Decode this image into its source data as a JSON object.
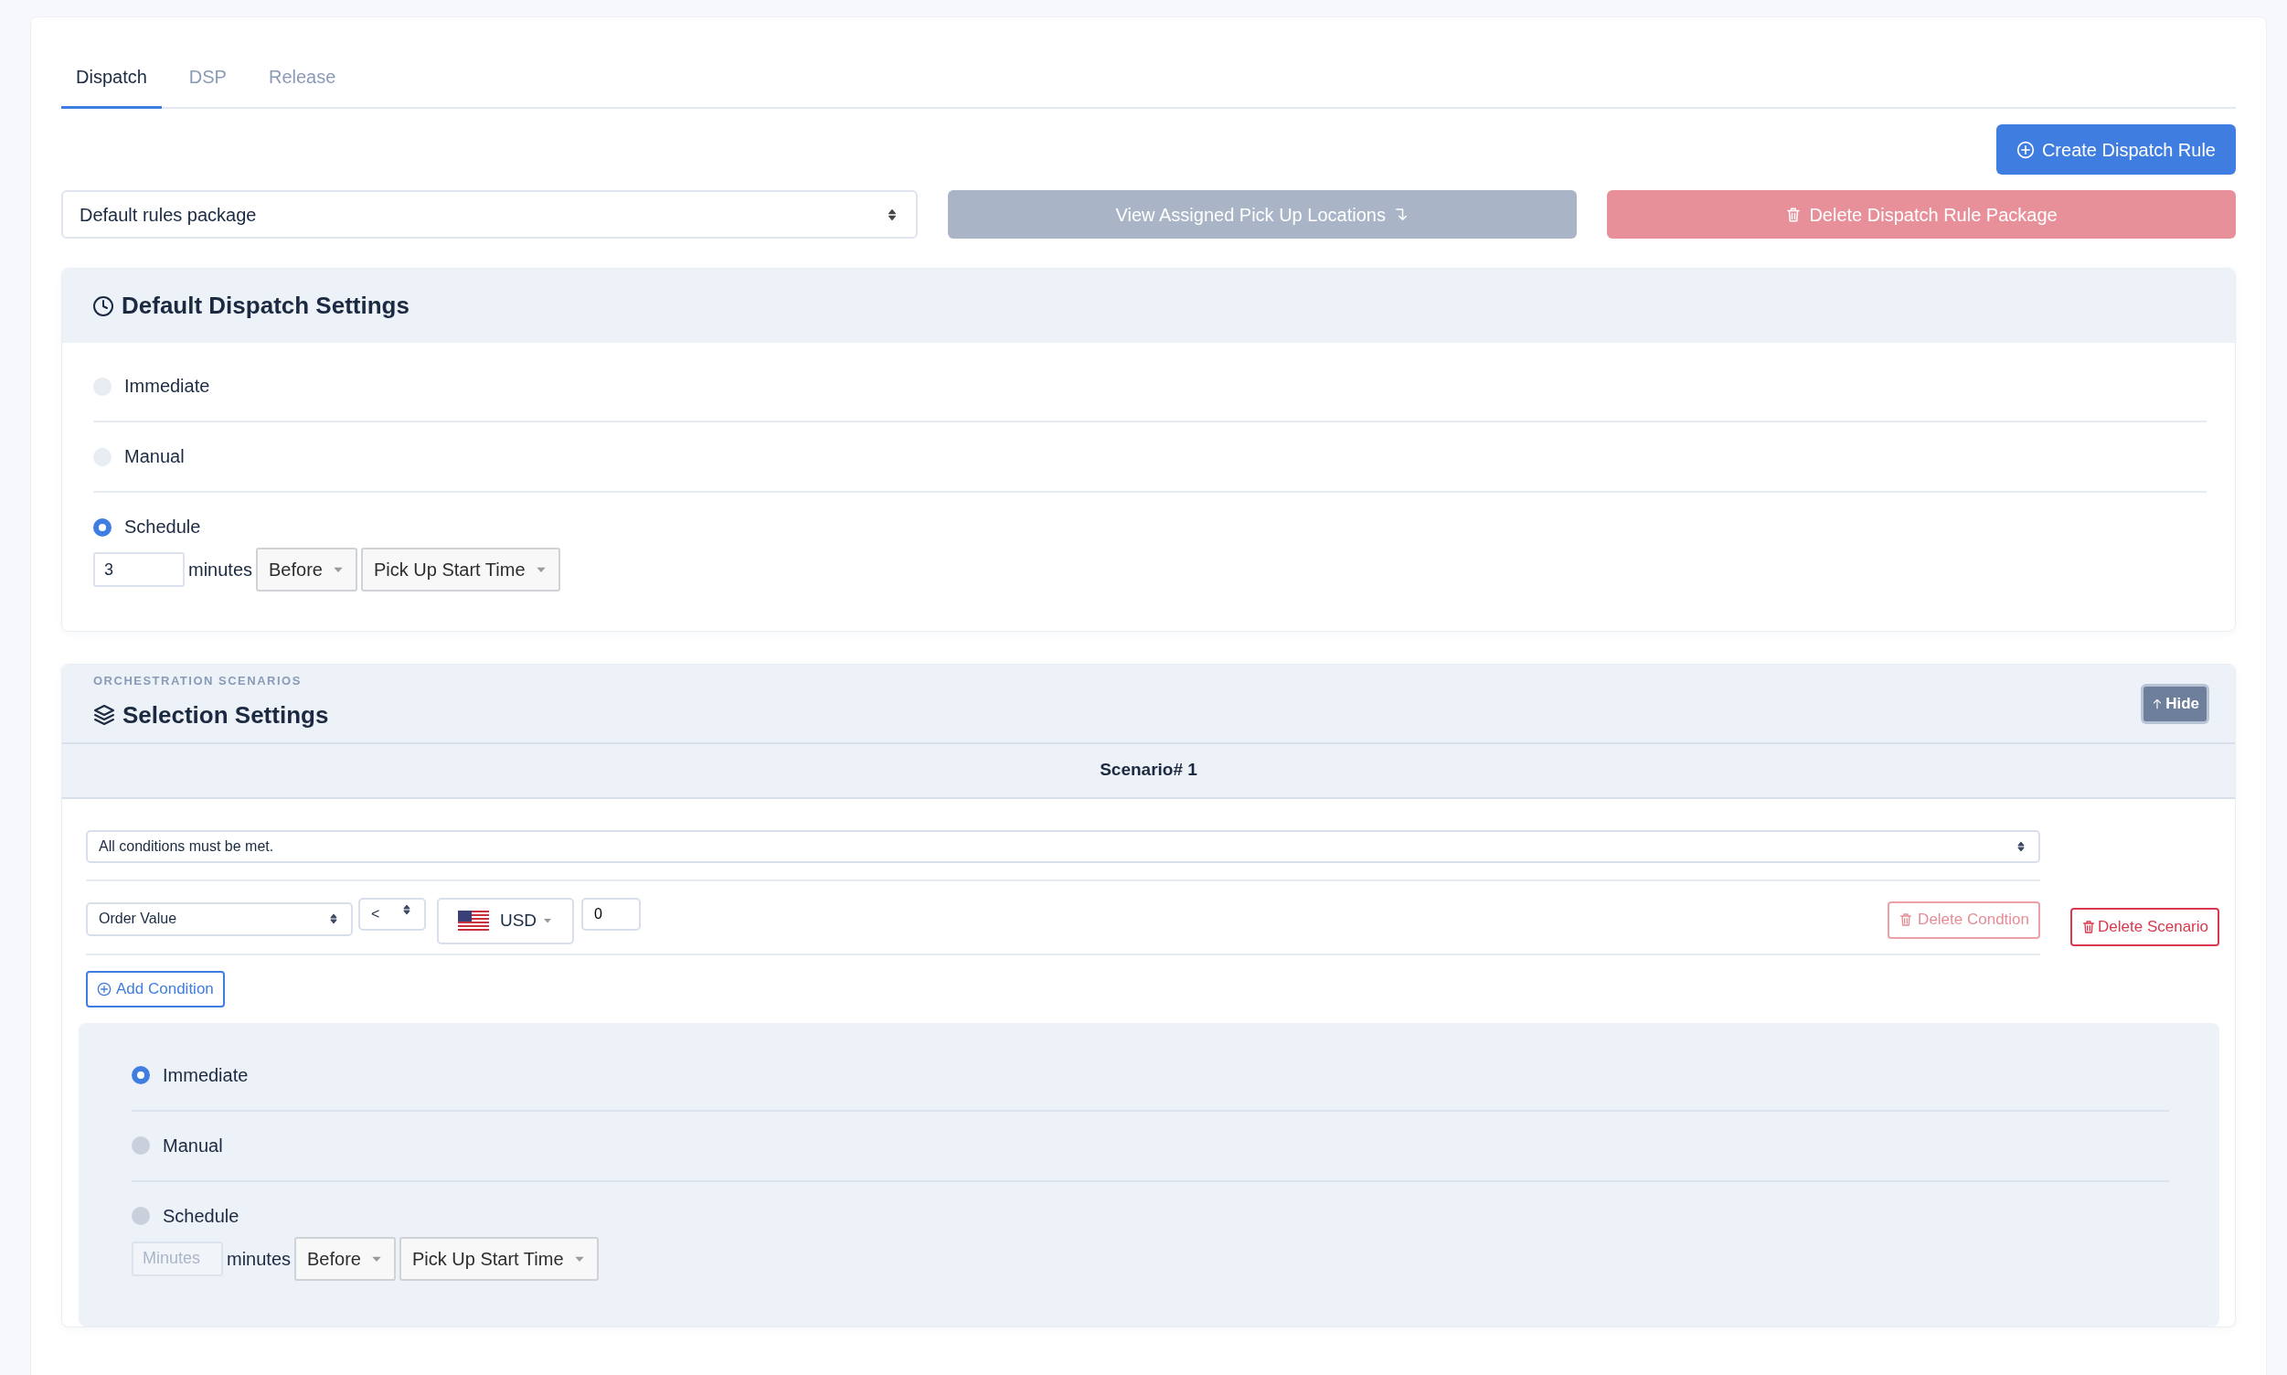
{
  "tabs": [
    {
      "label": "Dispatch",
      "selected": true
    },
    {
      "label": "DSP",
      "selected": false
    },
    {
      "label": "Release",
      "selected": false
    }
  ],
  "create_button": "Create Dispatch Rule",
  "package_select": {
    "value": "Default rules package"
  },
  "view_button": "View Assigned Pick Up Locations",
  "delete_package_button": "Delete Dispatch Rule Package",
  "default_settings": {
    "title": "Default Dispatch Settings",
    "options": [
      {
        "label": "Immediate",
        "selected": false
      },
      {
        "label": "Manual",
        "selected": false
      },
      {
        "label": "Schedule",
        "selected": true
      }
    ],
    "schedule": {
      "minutes_value": "3",
      "unit": "minutes",
      "relation": "Before",
      "reference": "Pick Up Start Time"
    }
  },
  "selection_settings": {
    "eyebrow": "ORCHESTRATION SCENARIOS",
    "title": "Selection Settings",
    "hide_button": "Hide",
    "scenarios": [
      {
        "title": "Scenario# 1",
        "match": "All conditions must be met.",
        "conditions": [
          {
            "field": "Order Value",
            "operator": "<",
            "currency": "USD",
            "amount": "0",
            "delete_button": "Delete Condtion"
          }
        ],
        "add_button": "Add Condition",
        "delete_button": "Delete Scenario",
        "options": [
          {
            "label": "Immediate",
            "selected": true
          },
          {
            "label": "Manual",
            "selected": false
          },
          {
            "label": "Schedule",
            "selected": false
          }
        ],
        "schedule": {
          "minutes_placeholder": "Minutes",
          "unit": "minutes",
          "relation": "Before",
          "reference": "Pick Up Start Time"
        }
      }
    ]
  }
}
